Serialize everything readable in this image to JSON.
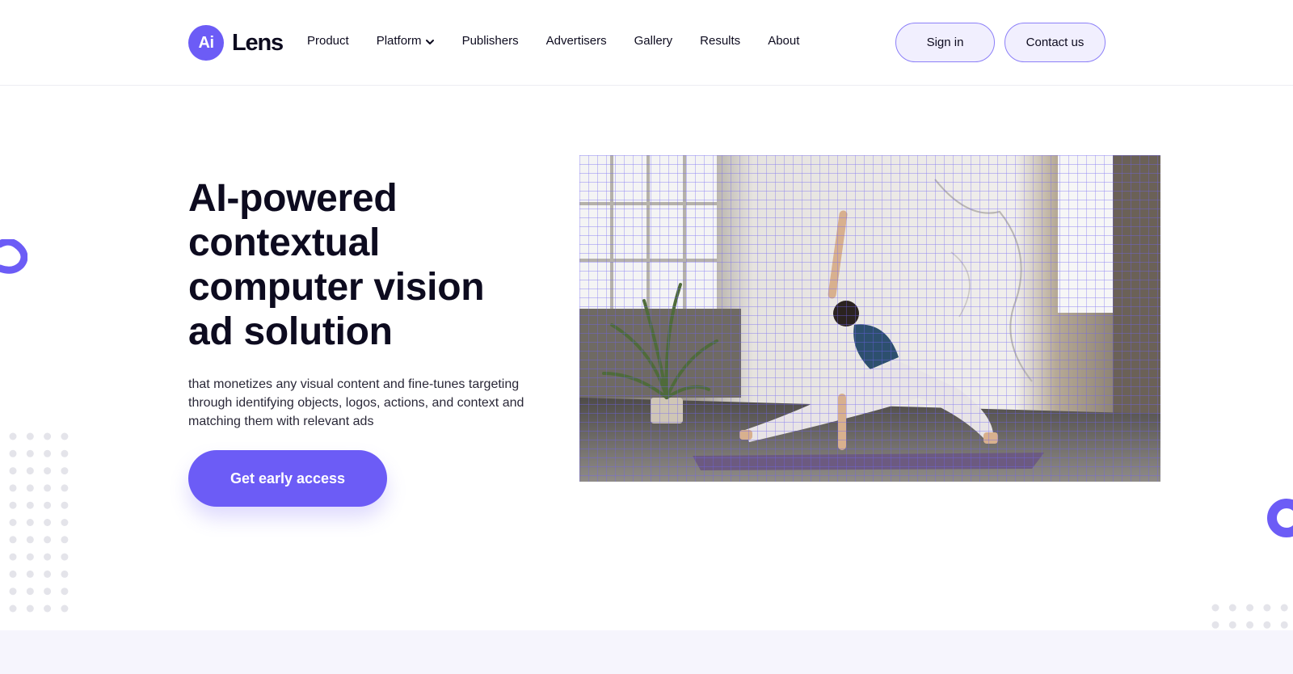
{
  "brand": {
    "badge": "Ai",
    "name": "Lens",
    "accent": "#6c5cf6"
  },
  "nav": {
    "items": [
      {
        "label": "Product"
      },
      {
        "label": "Platform",
        "has_dropdown": true,
        "icon": "chevron-down-icon"
      },
      {
        "label": "Publishers"
      },
      {
        "label": "Advertisers"
      },
      {
        "label": "Gallery"
      },
      {
        "label": "Results"
      },
      {
        "label": "About"
      }
    ],
    "sign_in": "Sign in",
    "contact": "Contact us"
  },
  "hero": {
    "title_lines": [
      "AI-powered",
      "contextual",
      "computer vision",
      "ad solution"
    ],
    "subtitle": "that monetizes any visual content and fine-tunes targeting through identifying objects, logos, actions, and context and matching them with relevant ads",
    "cta": "Get early access",
    "image": {
      "subject": "woman doing a yoga pose in a bright room with a plant, overlaid with a purple grid",
      "overlay": "grid"
    }
  },
  "colors": {
    "accent": "#6c5cf6",
    "button_bg_light": "#f1effe",
    "band": "#f6f5fd",
    "dots": "#e4e4ea"
  }
}
